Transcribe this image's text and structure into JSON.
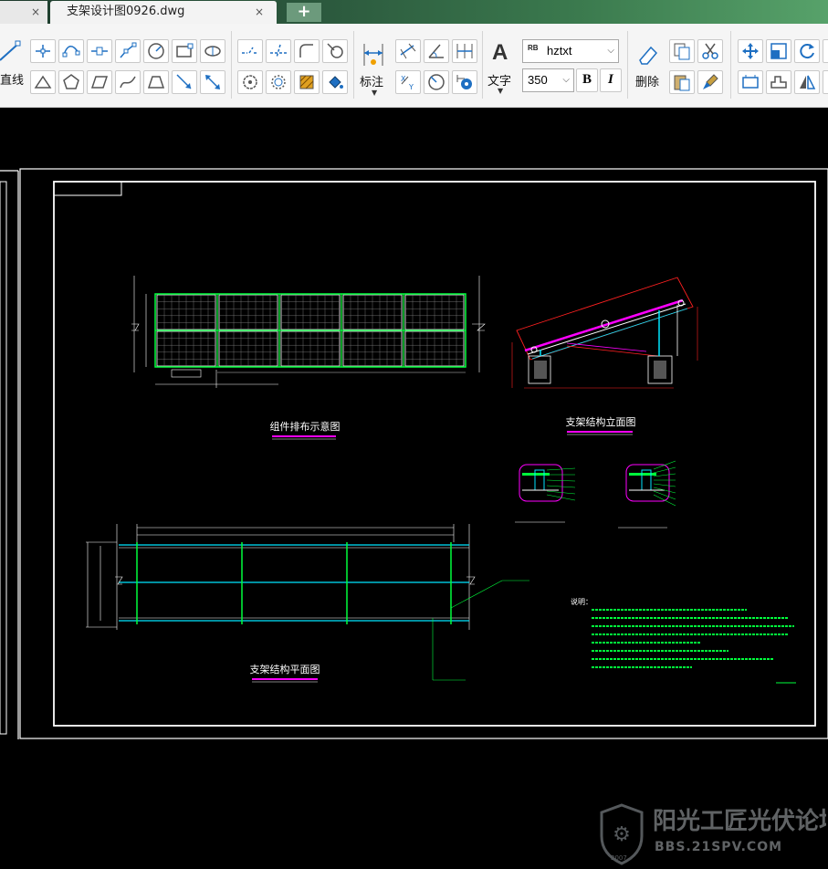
{
  "tabs": {
    "active_title": "支架设计图0926.dwg",
    "close_glyph": "×",
    "add_glyph": "+"
  },
  "ribbon": {
    "line_label": "直线",
    "dimension_label": "标注",
    "text_label": "文字",
    "text_icon": "A",
    "delete_label": "删除",
    "font_name": "hztxt",
    "font_badge": "RB",
    "text_height": "350",
    "bold_label": "B",
    "italic_label": "I"
  },
  "drawing": {
    "title_layout": "组件排布示意图",
    "title_elevation": "支架结构立面图",
    "title_plan": "支架结构平面图",
    "notes_header": "说明："
  },
  "watermark": {
    "name": "阳光工匠光伏论坛",
    "url": "BBS.21SPV.COM",
    "year": "2007"
  },
  "colors": {
    "tab_bar": "#2c5a3e",
    "ribbon_bg": "#f5f5f5",
    "canvas_bg": "#000000",
    "cad_white": "#ffffff",
    "cad_green": "#00ff3c",
    "cad_cyan": "#00e5ff",
    "cad_red": "#ff2020",
    "cad_magenta": "#ff00ff",
    "icon_blue": "#1e6fc2"
  }
}
